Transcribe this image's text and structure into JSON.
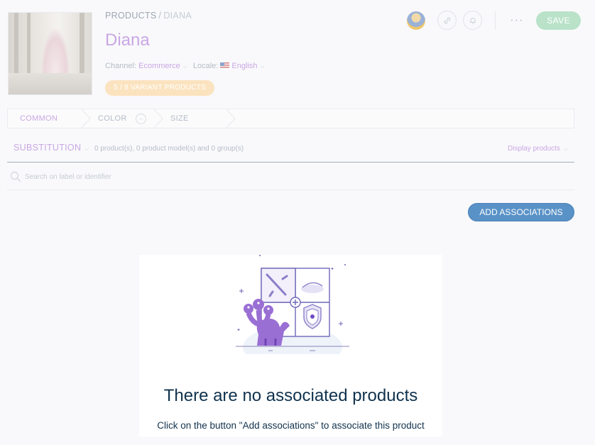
{
  "header": {
    "breadcrumb": {
      "root": "PRODUCTS",
      "separator": "/",
      "current": "DIANA"
    },
    "title": "Diana",
    "channel": {
      "label": "Channel:",
      "value": "Ecommerce"
    },
    "locale": {
      "label": "Locale:",
      "value": "English"
    },
    "variant_badge": "5 / 8 VARIANT PRODUCTS",
    "more_label": "···",
    "save_label": "SAVE"
  },
  "tabs": [
    {
      "label": "COMMON"
    },
    {
      "label": "COLOR"
    },
    {
      "label": "SIZE"
    }
  ],
  "associations": {
    "type": "SUBSTITUTION",
    "count_text": "0 product(s), 0 product model(s) and 0 group(s)",
    "display_label": "Display products"
  },
  "search": {
    "placeholder": "Search on label or identifier"
  },
  "add_button_label": "ADD ASSOCIATIONS",
  "empty_state": {
    "title": "There are no associated products",
    "subtitle": "Click on the button \"Add associations\" to associate this product"
  },
  "colors": {
    "brand_purple": "#c9a7e4",
    "save_green": "#b9e2c9",
    "primary_blue": "#5992c7",
    "badge_orange": "#fbe3bf",
    "text_dark": "#11324d"
  }
}
